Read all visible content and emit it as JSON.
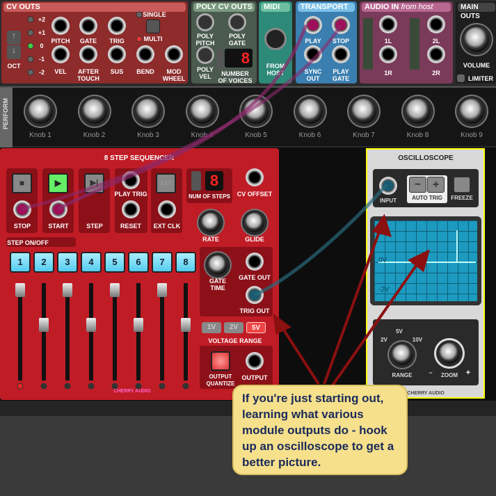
{
  "cv_outs": {
    "title": "CV OUTS",
    "oct_label": "OCT",
    "oct_levels": [
      "+2",
      "+1",
      "0",
      "-1",
      "-2"
    ],
    "active_oct": "0",
    "jacks_top": [
      "PITCH",
      "GATE",
      "TRIG"
    ],
    "jacks_bottom": [
      "VEL",
      "AFTER TOUCH",
      "SUS",
      "BEND",
      "MOD WHEEL"
    ],
    "mode_single": "SINGLE",
    "mode_multi": "MULTI"
  },
  "poly_cv_outs": {
    "title": "POLY CV OUTS",
    "jacks": [
      "POLY PITCH",
      "POLY GATE",
      "POLY VEL"
    ],
    "voices_label": "NUMBER OF VOICES",
    "voices_value": "8"
  },
  "midi": {
    "title": "MIDI",
    "label": "FROM HOST"
  },
  "transport": {
    "title": "TRANSPORT",
    "jacks": [
      "PLAY",
      "STOP",
      "SYNC OUT",
      "PLAY GATE"
    ]
  },
  "audio_in": {
    "title": "AUDIO IN",
    "title_suffix": "from host",
    "jacks": [
      "1L",
      "2L",
      "1R",
      "2R"
    ]
  },
  "main_outs": {
    "title": "MAIN OUTS",
    "volume": "VOLUME",
    "limiter": "LIMITER"
  },
  "perform": {
    "label": "PERFORM",
    "knobs": [
      "Knob 1",
      "Knob 2",
      "Knob 3",
      "Knob 4",
      "Knob 5",
      "Knob 6",
      "Knob 7",
      "Knob 8",
      "Knob 9"
    ]
  },
  "sequencer": {
    "title": "8 STEP SEQUENCER",
    "stop": "STOP",
    "start": "START",
    "step": "STEP",
    "play_trig": "PLAY TRIG",
    "reset": "RESET",
    "ext": "EXT",
    "ext_clk": "EXT CLK",
    "num_steps_label": "NUM OF STEPS",
    "num_steps": "8",
    "cv_offset": "CV OFFSET",
    "rate": "RATE",
    "glide": "GLIDE",
    "step_onoff": "STEP ON/OFF",
    "steps": [
      "1",
      "2",
      "3",
      "4",
      "5",
      "6",
      "7",
      "8"
    ],
    "gate_time": "GATE TIME",
    "gate_out": "GATE OUT",
    "trig_out": "TRIG OUT",
    "voltage_ranges": [
      "1V",
      "2V",
      "5V"
    ],
    "selected_range": "5V",
    "voltage_range_label": "VOLTAGE RANGE",
    "output_quantize": "OUTPUT QUANTIZE",
    "output": "OUTPUT",
    "brand": "CHERRY AUDIO"
  },
  "oscilloscope": {
    "title": "OSCILLOSCOPE",
    "input": "INPUT",
    "auto_trig": "AUTO TRIG",
    "minus": "−",
    "plus": "+",
    "freeze": "FREEZE",
    "grid_labels": [
      "2V",
      "0V",
      "-2V"
    ],
    "range": "RANGE",
    "range_marks": [
      "2V",
      "5V",
      "10V"
    ],
    "zoom": "ZOOM",
    "zoom_minus": "−",
    "zoom_plus": "+",
    "brand": "CHERRY AUDIO"
  },
  "callout": {
    "text": "If you're just starting out, learning what various module outputs do - hook up an oscilloscope to get a better picture."
  },
  "colors": {
    "annotation_arrow": "#8b1010",
    "callout_bg": "#f6e08c",
    "callout_text": "#1a2a5a",
    "scope_screen": "#1d9ac0"
  }
}
